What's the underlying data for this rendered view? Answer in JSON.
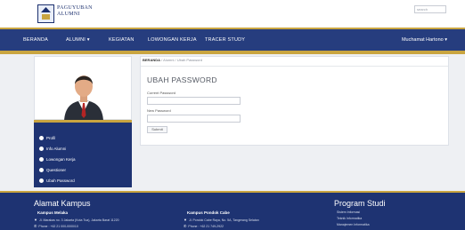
{
  "header": {
    "brand_line1": "PAGUYUBAN",
    "brand_line2": "ALUMNI",
    "search_placeholder": "search"
  },
  "nav": {
    "items": [
      "BERANDA",
      "ALUMNI ▾",
      "KEGIATAN",
      "LOWONGAN KERJA",
      "TRACER STUDY"
    ],
    "user": "Muchamat Hartono ▾"
  },
  "sidebar": {
    "menu": [
      "Profil",
      "Info Alumni",
      "Lowongan Kerja",
      "Questioner",
      "Ubah Password"
    ]
  },
  "breadcrumb": {
    "home": "BERANDA",
    "sep1": "/",
    "level2": "Alumni",
    "sep2": "/",
    "current": "Ubah Password"
  },
  "form": {
    "title": "UBAH PASSWORD",
    "current_label": "Current Password",
    "new_label": "New Password",
    "submit_label": "Submit"
  },
  "footer": {
    "address_title": "Alamat Kampus",
    "campus1_name": "Kampus Melaka",
    "campus1_address": "Jl. Marakas no. 3 Jakarta (Kota Tua), Jakarta Barat 11220",
    "campus1_phone": "Phone : +62 21 000-0000/10",
    "campus2_name": "Kampus Pondok Cabe",
    "campus2_address": "Jl. Pondok Cabe Raya, No. 5A, Tangerang Selatan",
    "campus2_phone": "Phone : +62 21 749-2922",
    "programs_title": "Program Studi",
    "programs": [
      "Sistem Informasi",
      "Teknik Informatika",
      "Manajemen Informatika"
    ]
  }
}
